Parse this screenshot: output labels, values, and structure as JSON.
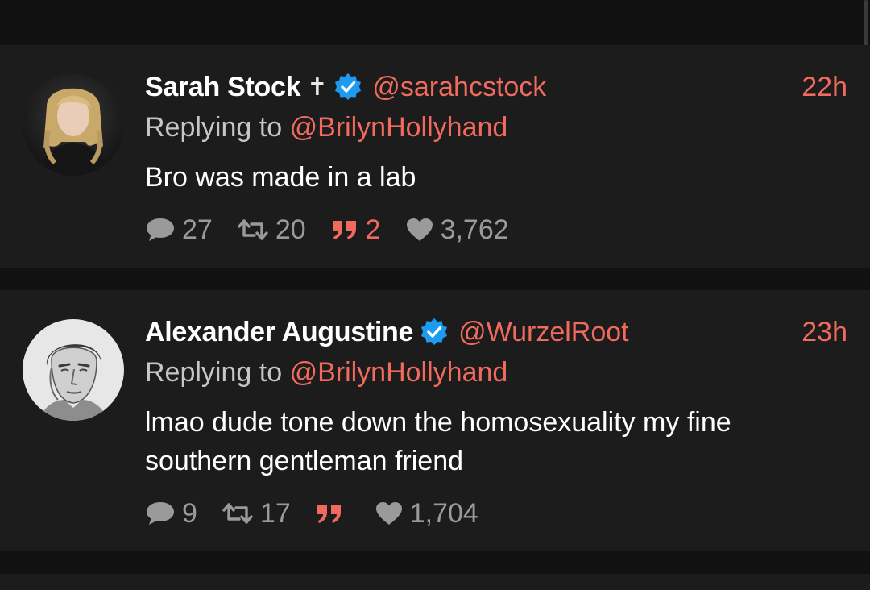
{
  "tweets": [
    {
      "display_name": "Sarah Stock",
      "name_emoji": "✝",
      "handle": "@sarahcstock",
      "time": "22h",
      "reply_prefix": "Replying to",
      "reply_handle": "@BrilynHollyhand",
      "text": "Bro was made in a lab",
      "replies": "27",
      "retweets": "20",
      "quotes": "2",
      "likes": "3,762"
    },
    {
      "display_name": "Alexander Augustine",
      "handle": "@WurzelRoot",
      "time": "23h",
      "reply_prefix": "Replying to",
      "reply_handle": "@BrilynHollyhand",
      "text": "lmao dude tone down the homosexuality my fine southern gentleman friend",
      "replies": "9",
      "retweets": "17",
      "likes": "1,704"
    }
  ],
  "colors": {
    "accent": "#f06a5e",
    "verified": "#1d9bf0",
    "card": "#1c1c1c",
    "background": "#111111"
  },
  "icons": [
    "reply-icon",
    "retweet-icon",
    "quote-icon",
    "like-icon",
    "verified-badge-icon"
  ]
}
